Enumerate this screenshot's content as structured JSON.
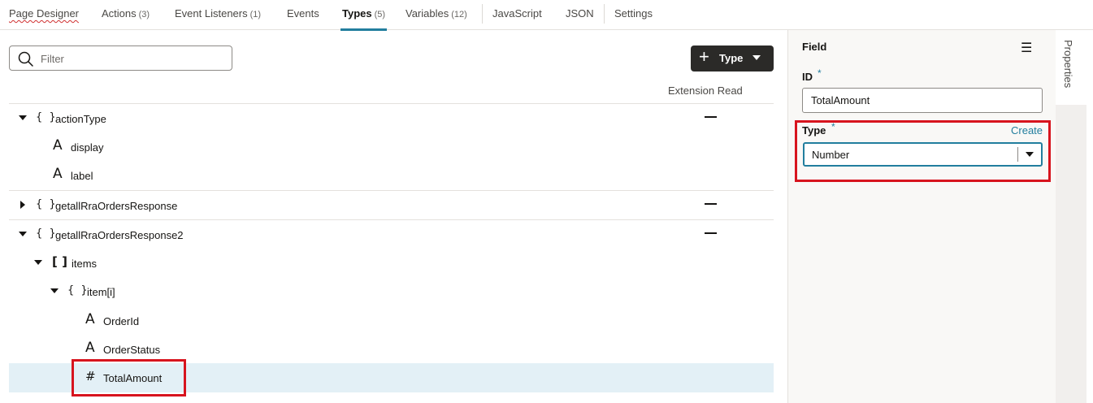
{
  "tabs": [
    {
      "label": "Page Designer",
      "count": ""
    },
    {
      "label": "Actions",
      "count": "(3)"
    },
    {
      "label": "Event Listeners",
      "count": "(1)"
    },
    {
      "label": "Events",
      "count": ""
    },
    {
      "label": "Types",
      "count": "(5)"
    },
    {
      "label": "Variables",
      "count": "(12)"
    },
    {
      "label": "JavaScript",
      "count": ""
    },
    {
      "label": "JSON",
      "count": ""
    },
    {
      "label": "Settings",
      "count": ""
    }
  ],
  "active_tab": "Types",
  "filter": {
    "placeholder": "Filter"
  },
  "add_type_button": {
    "label": "Type"
  },
  "column_header": "Extension Read",
  "tree": [
    {
      "label": "actionType",
      "kind": "object",
      "expanded": true,
      "extension_read": "—"
    },
    {
      "label": "display",
      "kind": "string"
    },
    {
      "label": "label",
      "kind": "string"
    },
    {
      "label": "getallRraOrdersResponse",
      "kind": "object",
      "expanded": false,
      "extension_read": "—"
    },
    {
      "label": "getallRraOrdersResponse2",
      "kind": "object",
      "expanded": true,
      "extension_read": "—"
    },
    {
      "label": "items",
      "kind": "array",
      "expanded": true
    },
    {
      "label": "item[i]",
      "kind": "object",
      "expanded": true
    },
    {
      "label": "OrderId",
      "kind": "string"
    },
    {
      "label": "OrderStatus",
      "kind": "string"
    },
    {
      "label": "TotalAmount",
      "kind": "number",
      "selected": true
    }
  ],
  "properties": {
    "title": "Field",
    "id_label": "ID",
    "id_value": "TotalAmount",
    "type_label": "Type",
    "create_link": "Create",
    "type_value": "Number",
    "required_marker": "*"
  },
  "side_tab": "Properties",
  "colors": {
    "accent": "#227e9e",
    "highlight": "#d7141e",
    "selected_row": "#e3f0f6",
    "button_dark": "#2b2a28"
  }
}
